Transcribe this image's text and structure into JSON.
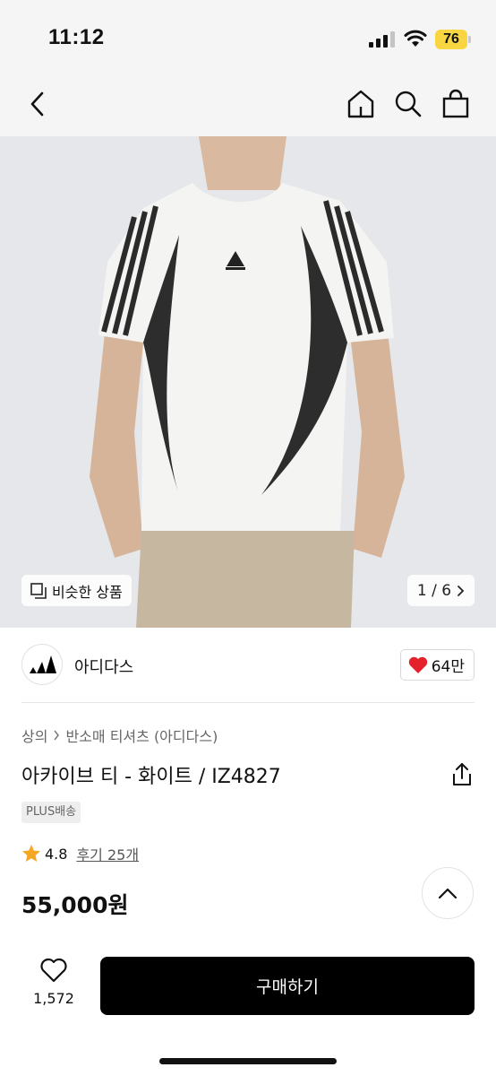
{
  "status": {
    "time": "11:12",
    "battery": "76",
    "battery_color": "#f7d641"
  },
  "nav": {
    "back_icon": "chevron-left-icon",
    "home_icon": "home-icon",
    "search_icon": "search-icon",
    "cart_icon": "shopping-bag-icon"
  },
  "gallery": {
    "similar_label": "비슷한 상품",
    "counter": "1 / 6",
    "background": "#e6e7eb"
  },
  "brand": {
    "name": "아디다스",
    "likes": "64만",
    "heart_color": "#e5222b"
  },
  "breadcrumb": {
    "category": "상의",
    "subcategory": "반소매 티셔츠 (아디다스)"
  },
  "product": {
    "title": "아카이브 티 - 화이트 / IZ4827",
    "shipping_badge": "PLUS배송",
    "rating": "4.8",
    "reviews": "후기 25개",
    "price": "55,000원",
    "star_color": "#f5a623"
  },
  "bottom": {
    "wish_count": "1,572",
    "buy_label": "구매하기"
  }
}
